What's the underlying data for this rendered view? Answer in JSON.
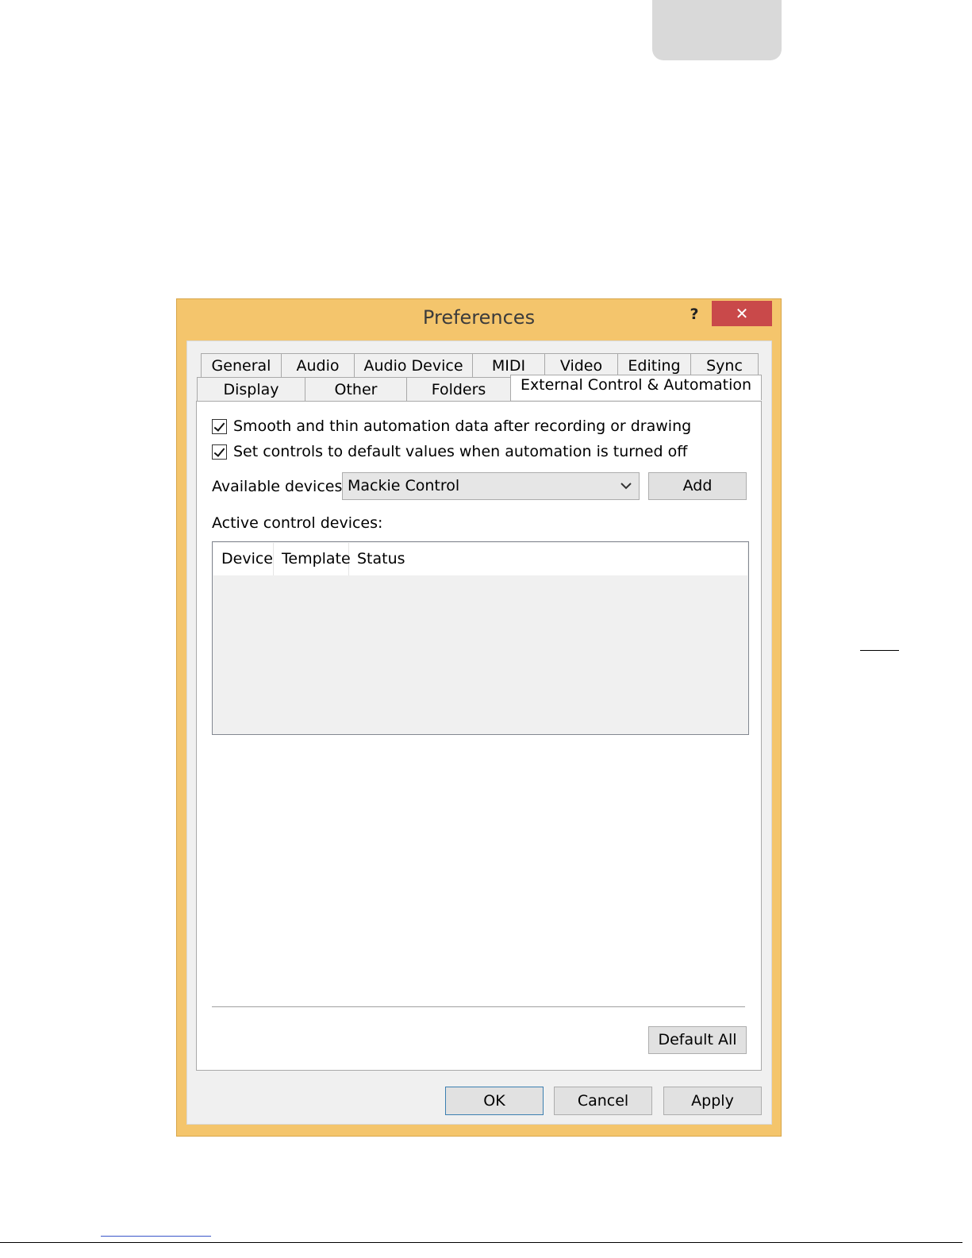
{
  "window": {
    "title": "Preferences",
    "help_label": "?",
    "close_label": "✕"
  },
  "tabs": {
    "row1": [
      "General",
      "Audio",
      "Audio Device",
      "MIDI",
      "Video",
      "Editing",
      "Sync"
    ],
    "row2": [
      "Display",
      "Other",
      "Folders",
      "External Control & Automation"
    ],
    "active": "External Control & Automation"
  },
  "options": {
    "smooth_label": "Smooth and thin automation data after recording or drawing",
    "smooth_checked": true,
    "defaults_label": "Set controls to default values when automation is turned off",
    "defaults_checked": true
  },
  "devices": {
    "available_label": "Available devices:",
    "available_value": "Mackie Control",
    "add_label": "Add",
    "active_label": "Active control devices:",
    "columns": [
      "Device",
      "Template",
      "Status"
    ],
    "rows": []
  },
  "footer": {
    "default_all_label": "Default All",
    "ok_label": "OK",
    "cancel_label": "Cancel",
    "apply_label": "Apply"
  },
  "colors": {
    "frame": "#f4c56c",
    "close": "#c9494a",
    "ok_border": "#3c7fb1"
  }
}
